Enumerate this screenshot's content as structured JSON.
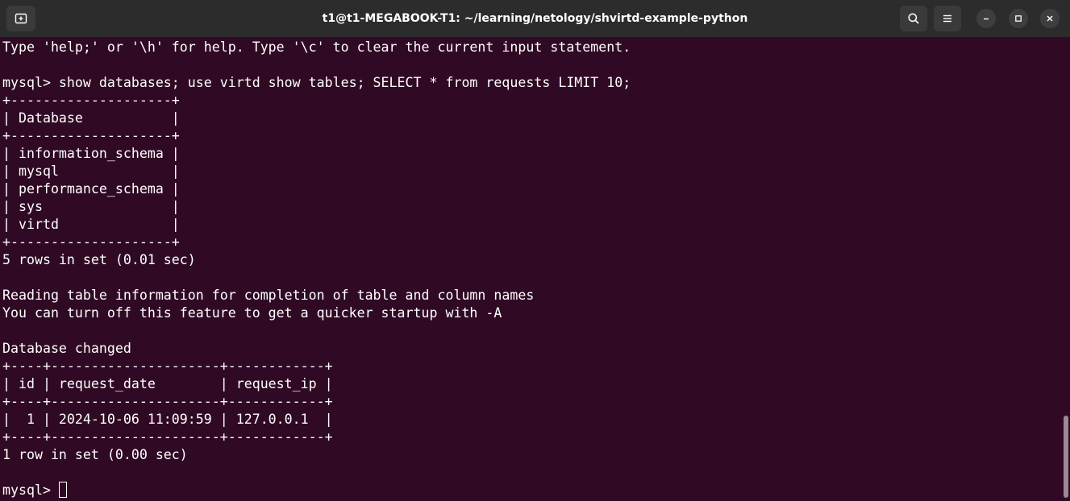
{
  "window": {
    "title": "t1@t1-MEGABOOK-T1: ~/learning/netology/shvirtd-example-python",
    "icons": {
      "new_tab": "new-tab-icon",
      "search": "search-icon",
      "menu": "hamburger-menu-icon",
      "minimize": "minimize-icon",
      "maximize": "maximize-icon",
      "close": "close-icon"
    }
  },
  "colors": {
    "terminal_bg": "#300a24",
    "titlebar_bg": "#2c2c2c",
    "text": "#ffffff"
  },
  "terminal": {
    "lines": [
      "Type 'help;' or '\\h' for help. Type '\\c' to clear the current input statement.",
      "",
      "mysql> show databases; use virtd show tables; SELECT * from requests LIMIT 10;",
      "+--------------------+",
      "| Database           |",
      "+--------------------+",
      "| information_schema |",
      "| mysql              |",
      "| performance_schema |",
      "| sys                |",
      "| virtd              |",
      "+--------------------+",
      "5 rows in set (0.01 sec)",
      "",
      "Reading table information for completion of table and column names",
      "You can turn off this feature to get a quicker startup with -A",
      "",
      "Database changed",
      "+----+---------------------+------------+",
      "| id | request_date        | request_ip |",
      "+----+---------------------+------------+",
      "|  1 | 2024-10-06 11:09:59 | 127.0.0.1  |",
      "+----+---------------------+------------+",
      "1 row in set (0.00 sec)",
      "",
      "mysql> "
    ]
  }
}
